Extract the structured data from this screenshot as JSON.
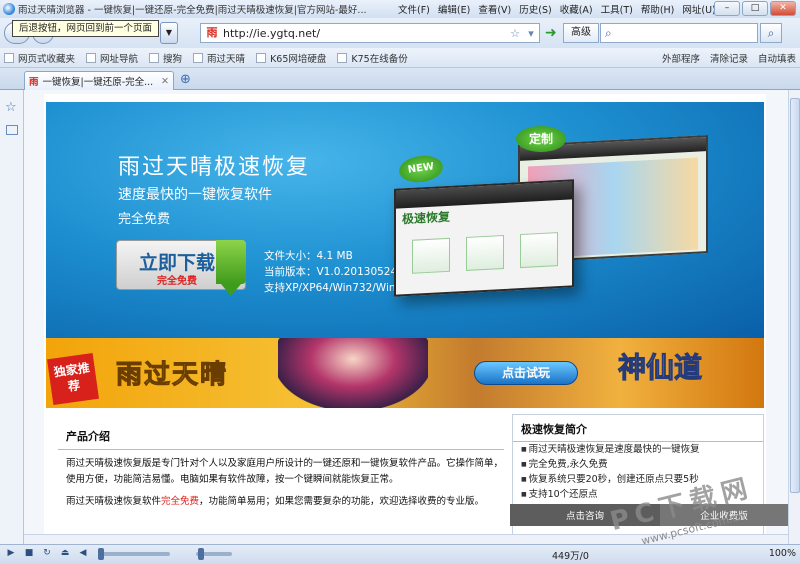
{
  "window": {
    "title": "雨过天晴浏览器 - 一键恢复|一键还原-完全免费|雨过天晴极速恢复|官方网站-最好...",
    "menu": [
      "文件(F)",
      "编辑(E)",
      "查看(V)",
      "历史(S)",
      "收藏(A)",
      "工具(T)",
      "帮助(H)",
      "网址(U)"
    ]
  },
  "tooltip": "后退按钮，网页回到前一个页面",
  "address": {
    "url": "http://ie.ygtq.net/",
    "icon": "雨"
  },
  "search": {
    "advanced": "高级",
    "placeholder": ""
  },
  "favorites": [
    "网页式收藏夹",
    "网址导航",
    "搜狗",
    "雨过天晴",
    "K65网培硬盘",
    "K75在线备份"
  ],
  "favright": [
    "外部程序",
    "清除记录",
    "自动填表"
  ],
  "tab": {
    "label": "一键恢复|一键还原-完全...",
    "icon": "雨"
  },
  "banner": {
    "title": "雨过天晴极速恢复",
    "sub1": "速度最快的一键恢复软件",
    "sub2": "完全免费",
    "download": "立即下载",
    "download_sub": "完全免费",
    "size": "文件大小：4.1 MB",
    "version": "当前版本：V1.0.20130524",
    "support": "支持XP/XP64/Win732/Win764",
    "new": "NEW",
    "custom": "定制",
    "app_logo": "极速恢复"
  },
  "ad": {
    "exclusive": "独家推荐",
    "title": "雨过天晴",
    "try": "点击试玩",
    "game": "神仙道"
  },
  "intro": {
    "title": "产品介绍",
    "p1a": "雨过天晴极速恢复版是专门针对个人以及家庭用户所设计的一键还原和一键恢复软件产品。它操作简单，使用方便，功能简洁易懂。电脑如果有软件故障，按一个键瞬间就能恢复正常。",
    "p2a": "雨过天晴极速恢复软件",
    "p2red": "完全免费",
    "p2b": "，功能简单易用；如果您需要复杂的功能，欢迎选择收费的专业版。"
  },
  "brief": {
    "title": "极速恢复简介",
    "items": [
      "雨过天晴极速恢复是速度最快的一键恢复",
      "完全免费,永久免费",
      "恢复系统只要20秒，创建还原点只要5秒",
      "支持10个还原点"
    ]
  },
  "chat": {
    "consult": "点击咨询",
    "enterprise": "企业收费版"
  },
  "status": {
    "count": "449万/0",
    "zoom": "100%"
  },
  "watermark": {
    "brand": "PC下载网",
    "url": "www.pcsoft.com.cn"
  }
}
